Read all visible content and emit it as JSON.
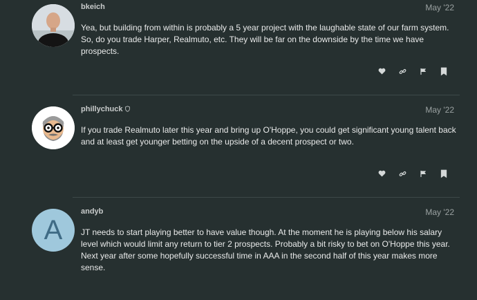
{
  "posts": [
    {
      "username": "bkeich",
      "date": "May '22",
      "text": "Yea, but building from within is probably a 5 year project with the laughable state of our farm system. So, do you trade Harper, Realmuto, etc. They will be far on the downside by the time we have prospects.",
      "avatar": "photo",
      "shield": false
    },
    {
      "username": "phillychuck",
      "date": "May '22",
      "text": "If you trade Realmuto later this year and bring up O'Hoppe, you could get significant young talent back and at least get younger betting on the upside of a decent prospect or two.",
      "avatar": "cartoon-face",
      "shield": true
    },
    {
      "username": "andyb",
      "date": "May '22",
      "text": "JT needs to start playing better to have value though. At the moment he is playing below his salary level which would limit any return to tier 2 prospects. Probably a bit risky to bet on O'Hoppe this year. Next year after some hopefully successful time in AAA in the second half of this year makes more sense.",
      "avatar": "letter",
      "avatar_letter": "A",
      "shield": false
    }
  ],
  "icons": [
    "heart-icon",
    "link-icon",
    "flag-icon",
    "bookmark-icon"
  ],
  "colors": {
    "background": "#263030",
    "text": "#e9eaea",
    "muted": "#9aa1a1",
    "andyb_avatar_bg": "#9fc8dc",
    "andyb_avatar_letter": "#3f6b85"
  }
}
